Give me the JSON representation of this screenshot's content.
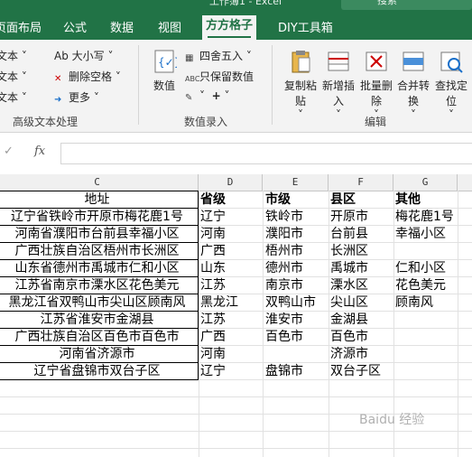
{
  "title": {
    "text": "工作簿1 - Excel",
    "search_placeholder": "搜索"
  },
  "tabs": [
    {
      "label": "页面布局"
    },
    {
      "label": "公式"
    },
    {
      "label": "数据"
    },
    {
      "label": "视图"
    },
    {
      "label": "方方格子",
      "active": true
    },
    {
      "label": "DIY工具箱"
    }
  ],
  "ribbon": {
    "text_group": {
      "items": [
        "文本",
        "文本",
        "文本"
      ],
      "upper": "Ab 大小写",
      "delete_space": "删除空格",
      "more": "更多",
      "label": "高级文本处理"
    },
    "entry_group": {
      "number": "数值",
      "round": "四舍五入",
      "keep_values": "只保留数值",
      "label": "数值录入"
    },
    "edit_group": {
      "copy_paste": "复制粘贴",
      "insert": "新增插入",
      "delete": "批量删除",
      "merge": "合并转换",
      "locate": "查找定位",
      "label": "编辑"
    }
  },
  "formula_bar": {
    "fx": "fx",
    "value": ""
  },
  "columns": [
    "C",
    "D",
    "E",
    "F",
    "G"
  ],
  "rows": [
    {
      "c": "地址",
      "d": "省级",
      "e": "市级",
      "f": "县区",
      "g": "其他",
      "header": true
    },
    {
      "c": "辽宁省铁岭市开原市梅花鹿1号",
      "d": "辽宁",
      "e": "铁岭市",
      "f": "开原市",
      "g": "梅花鹿1号"
    },
    {
      "c": "河南省濮阳市台前县幸福小区",
      "d": "河南",
      "e": "濮阳市",
      "f": "台前县",
      "g": "幸福小区"
    },
    {
      "c": "广西壮族自治区梧州市长洲区",
      "d": "广西",
      "e": "梧州市",
      "f": "长洲区",
      "g": ""
    },
    {
      "c": "山东省德州市禹城市仁和小区",
      "d": "山东",
      "e": "德州市",
      "f": "禹城市",
      "g": "仁和小区"
    },
    {
      "c": "江苏省南京市溧水区花色美元",
      "d": "江苏",
      "e": "南京市",
      "f": "溧水区",
      "g": "花色美元"
    },
    {
      "c": "黑龙江省双鸭山市尖山区顾南风",
      "d": "黑龙江",
      "e": "双鸭山市",
      "f": "尖山区",
      "g": "顾南风"
    },
    {
      "c": "江苏省淮安市金湖县",
      "d": "江苏",
      "e": "淮安市",
      "f": "金湖县",
      "g": ""
    },
    {
      "c": "广西壮族自治区百色市百色市",
      "d": "广西",
      "e": "百色市",
      "f": "百色市",
      "g": ""
    },
    {
      "c": "河南省济源市",
      "d": "河南",
      "e": "",
      "f": "济源市",
      "g": ""
    },
    {
      "c": "辽宁省盘锦市双台子区",
      "d": "辽宁",
      "e": "盘锦市",
      "f": "双台子区",
      "g": ""
    }
  ],
  "watermark": "Baidu 经验"
}
